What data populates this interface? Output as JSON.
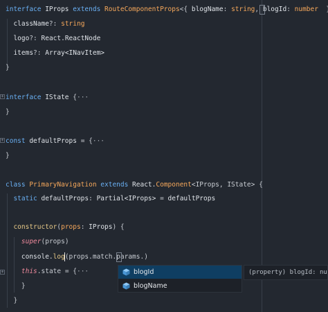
{
  "editor": {
    "lines": [
      [
        {
          "t": "interface ",
          "c": "kw"
        },
        {
          "t": "IProps ",
          "c": "prop"
        },
        {
          "t": "extends ",
          "c": "kw"
        },
        {
          "t": "RouteComponentProps",
          "c": "cls"
        },
        {
          "t": "<{ ",
          "c": "punc"
        },
        {
          "t": "blogName",
          "c": "prop"
        },
        {
          "t": ": ",
          "c": "punc"
        },
        {
          "t": "string",
          "c": "typ"
        },
        {
          "t": ", ",
          "c": "punc"
        },
        {
          "t": "blogId",
          "c": "prop"
        },
        {
          "t": ": ",
          "c": "punc"
        },
        {
          "t": "number",
          "c": "typ"
        },
        {
          "t": "  }> {",
          "c": "punc"
        }
      ],
      [
        {
          "t": "  className",
          "c": "prop"
        },
        {
          "t": "?: ",
          "c": "punc"
        },
        {
          "t": "string",
          "c": "typ"
        }
      ],
      [
        {
          "t": "  logo",
          "c": "prop"
        },
        {
          "t": "?: ",
          "c": "punc"
        },
        {
          "t": "React.ReactNode",
          "c": "prop"
        }
      ],
      [
        {
          "t": "  items",
          "c": "prop"
        },
        {
          "t": "?: ",
          "c": "punc"
        },
        {
          "t": "Array<INavItem>",
          "c": "prop"
        }
      ],
      [
        {
          "t": "}",
          "c": "punc"
        }
      ],
      [
        {
          "t": "interface ",
          "c": "kw"
        },
        {
          "t": "IState ",
          "c": "prop"
        },
        {
          "t": "{",
          "c": "punc"
        },
        {
          "t": "···",
          "c": "dim"
        }
      ],
      [
        {
          "t": "}",
          "c": "punc"
        }
      ],
      [
        {
          "t": "const ",
          "c": "kw"
        },
        {
          "t": "defaultProps ",
          "c": "prop"
        },
        {
          "t": "= {",
          "c": "punc"
        },
        {
          "t": "···",
          "c": "dim"
        }
      ],
      [
        {
          "t": "}",
          "c": "punc"
        }
      ],
      [
        {
          "t": "class ",
          "c": "kw"
        },
        {
          "t": "PrimaryNavigation ",
          "c": "cls"
        },
        {
          "t": "extends ",
          "c": "kw"
        },
        {
          "t": "React.",
          "c": "prop"
        },
        {
          "t": "Component",
          "c": "cls"
        },
        {
          "t": "<IProps, IState> {",
          "c": "punc"
        }
      ],
      [
        {
          "t": "  static ",
          "c": "kw"
        },
        {
          "t": "defaultProps",
          "c": "prop"
        },
        {
          "t": ": ",
          "c": "punc"
        },
        {
          "t": "Partial<IProps> ",
          "c": "prop"
        },
        {
          "t": "= ",
          "c": "punc"
        },
        {
          "t": "defaultProps",
          "c": "prop"
        }
      ],
      [
        {
          "t": "  constructor",
          "c": "fn"
        },
        {
          "t": "(",
          "c": "punc"
        },
        {
          "t": "props",
          "c": "cls"
        },
        {
          "t": ": ",
          "c": "punc"
        },
        {
          "t": "IProps",
          "c": "prop"
        },
        {
          "t": ") {",
          "c": "punc"
        }
      ],
      [
        {
          "t": "    ",
          "c": "punc"
        },
        {
          "t": "super",
          "c": "em"
        },
        {
          "t": "(props)",
          "c": "punc"
        }
      ],
      [
        {
          "t": "    console.",
          "c": "prop"
        },
        {
          "t": "log",
          "c": "fn"
        },
        {
          "t": "(props.match.params.)",
          "c": "punc"
        }
      ],
      [
        {
          "t": "    ",
          "c": "punc"
        },
        {
          "t": "this",
          "c": "em"
        },
        {
          "t": ".state = {",
          "c": "punc"
        },
        {
          "t": "···",
          "c": "dim"
        }
      ],
      [
        {
          "t": "    }",
          "c": "punc"
        }
      ],
      [
        {
          "t": "  }",
          "c": "punc"
        }
      ]
    ]
  },
  "suggest": {
    "items": [
      {
        "label": "blogId",
        "icon": "property-icon"
      },
      {
        "label": "blogName",
        "icon": "property-icon"
      }
    ],
    "detail": "(property) blogId: number"
  },
  "colors": {
    "background": "#232830",
    "keyword": "#6ab0f3",
    "type": "#f6a85b",
    "function": "#e7c987",
    "selection": "#0f3e62"
  }
}
